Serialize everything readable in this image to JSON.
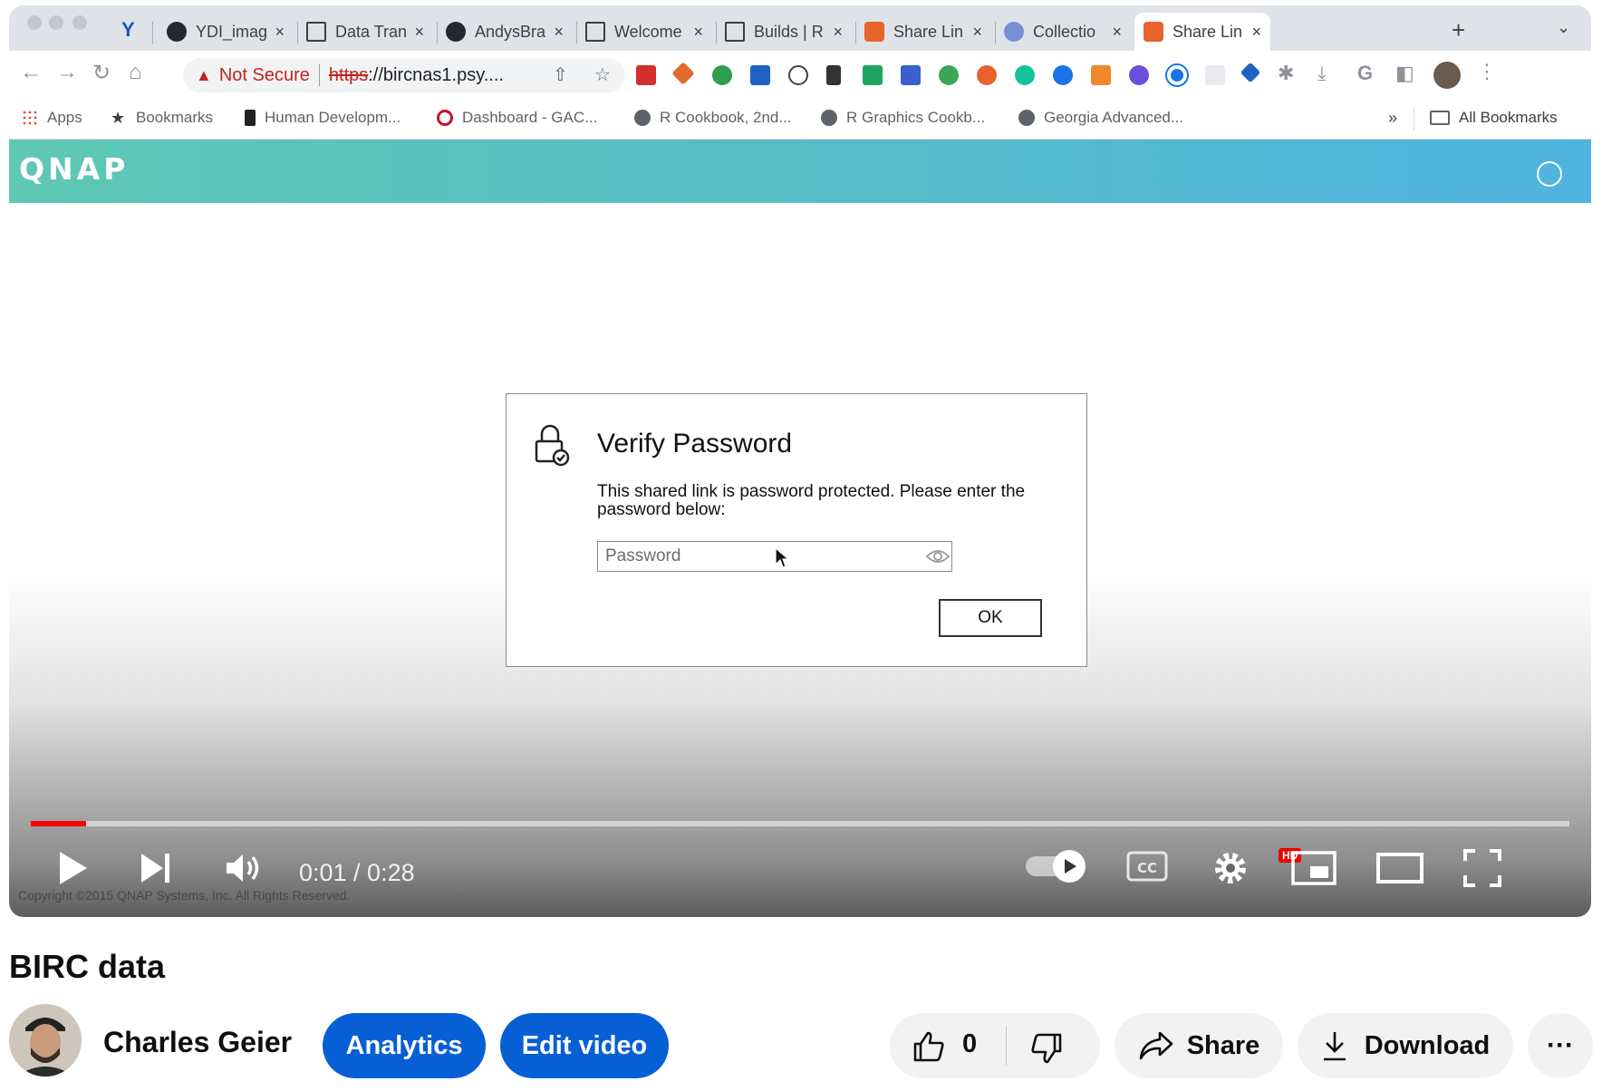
{
  "browser": {
    "tabs": [
      {
        "title": "YDI_imag"
      },
      {
        "title": "Data Tran"
      },
      {
        "title": "AndysBra"
      },
      {
        "title": "Welcome"
      },
      {
        "title": "Builds | R"
      },
      {
        "title": "Share Lin"
      },
      {
        "title": "Collectio"
      },
      {
        "title": "Share Lin"
      }
    ],
    "tab_close_glyph": "×",
    "new_tab_glyph": "+",
    "address": {
      "warning_label": "Not Secure",
      "url_scheme": "https",
      "url_rest": "://bircnas1.psy...."
    },
    "bookmarks": {
      "apps": "Apps",
      "items": [
        "Bookmarks",
        "Human Developm...",
        "Dashboard - GAC...",
        "R Cookbook, 2nd...",
        "R Graphics Cookb...",
        "Georgia Advanced..."
      ],
      "overflow": "»",
      "all": "All Bookmarks"
    }
  },
  "qnap": {
    "logo": "QNAP",
    "dialog": {
      "title": "Verify Password",
      "message": "This shared link is password protected. Please enter the password below:",
      "password_placeholder": "Password",
      "ok_label": "OK"
    },
    "copyright": "Copyright ©2015 QNAP Systems, Inc. All Rights Reserved."
  },
  "player": {
    "time": "0:01 / 0:28",
    "progress": 0.036,
    "hd_badge": "HD",
    "accent": "#ff0000"
  },
  "video": {
    "title": "BIRC data",
    "channel": "Charles Geier",
    "analytics_label": "Analytics",
    "edit_label": "Edit video",
    "like_count": "0",
    "share_label": "Share",
    "download_label": "Download",
    "more_glyph": "···"
  },
  "colors": {
    "youtube_blue": "#065fd4",
    "qnap_teal": "#5ec8b4",
    "qnap_blue": "#4fb3e0",
    "not_secure": "#c5221f"
  }
}
